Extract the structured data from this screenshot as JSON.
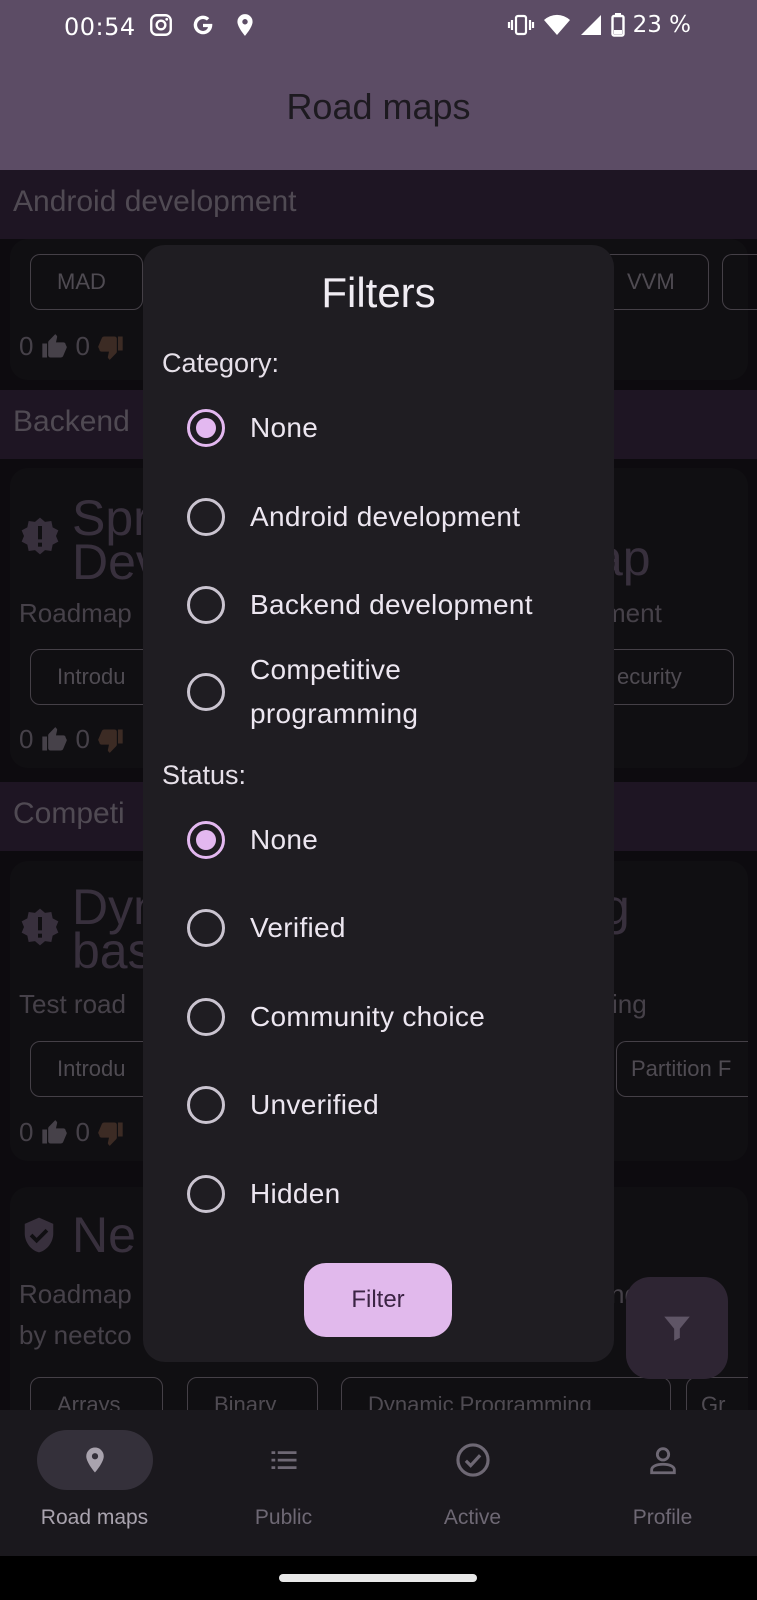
{
  "status_bar": {
    "time": "00:54",
    "battery": "23 %",
    "icons_left": [
      "instagram-icon",
      "google-icon",
      "location-icon"
    ],
    "icons_right": [
      "vibrate-icon",
      "wifi-icon",
      "cell-signal-icon",
      "battery-icon"
    ]
  },
  "app_bar": {
    "title": "Road maps"
  },
  "background": {
    "sections": [
      {
        "title": "Android development"
      },
      {
        "title": "Backend"
      },
      {
        "title": "Competi"
      }
    ],
    "cards": [
      {
        "chips": [
          "MAD",
          "VVM"
        ],
        "up_votes": "0",
        "down_votes": "0"
      },
      {
        "title_lines": [
          "Spr",
          "Dev"
        ],
        "title_right": "ap",
        "desc": "Roadmap",
        "desc_right": "ment",
        "chips": [
          "Introdu",
          "ecurity"
        ],
        "up_votes": "0",
        "down_votes": "0"
      },
      {
        "title_lines": [
          "Dyn",
          "basi"
        ],
        "title_right": "g",
        "desc": "Test road",
        "desc_right": "ing",
        "chips": [
          "Introdu",
          "Partition F"
        ],
        "up_votes": "0",
        "down_votes": "0"
      },
      {
        "title_lines": [
          "Ne"
        ],
        "desc": "Roadmap",
        "desc_line2": "by neetco",
        "desc_right": "ng",
        "chips": [
          "Arrays",
          "Binary",
          "Dynamic Programming",
          "Gr"
        ]
      }
    ]
  },
  "dialog": {
    "title": "Filters",
    "category_label": "Category:",
    "category_options": [
      "None",
      "Android development",
      "Backend development",
      "Competitive programming"
    ],
    "category_selected": "None",
    "status_label": "Status:",
    "status_options": [
      "None",
      "Verified",
      "Community choice",
      "Unverified",
      "Hidden"
    ],
    "status_selected": "None",
    "filter_button": "Filter"
  },
  "bottom_nav": {
    "items": [
      {
        "label": "Road maps",
        "icon": "location-pin-icon",
        "active": true
      },
      {
        "label": "Public",
        "icon": "list-icon",
        "active": false
      },
      {
        "label": "Active",
        "icon": "check-circle-icon",
        "active": false
      },
      {
        "label": "Profile",
        "icon": "person-icon",
        "active": false
      }
    ]
  },
  "colors": {
    "app_bar": "#5c4c65",
    "dialog_bg": "#1f1d22",
    "radio_selected": "#e3b8f0",
    "filter_button": "#e1b9ec"
  }
}
